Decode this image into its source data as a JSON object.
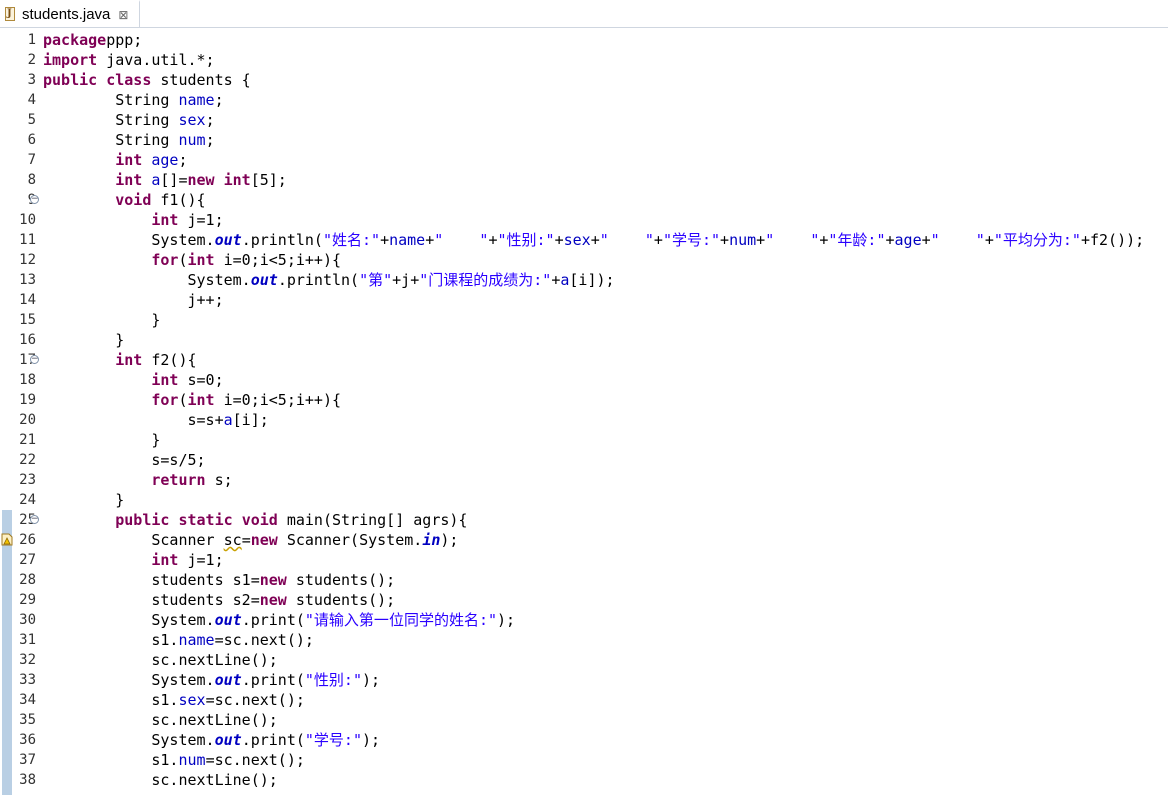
{
  "tab": {
    "title": "students.java",
    "close": "⊠",
    "icon": "java-file-icon"
  },
  "colors": {
    "keyword": "#7f0055",
    "field": "#0000c0",
    "string": "#2a00ff",
    "line_number": "#333333",
    "ruler_marker": "#b9cfe4"
  },
  "lines": [
    {
      "n": "1",
      "t": [
        [
          "kw",
          "package"
        ],
        [
          "",
          "ppp;"
        ]
      ]
    },
    {
      "n": "2",
      "t": [
        [
          "kw",
          "import"
        ],
        [
          "",
          " java.util.*;"
        ]
      ]
    },
    {
      "n": "3",
      "t": [
        [
          "kw",
          "public"
        ],
        [
          "",
          " "
        ],
        [
          "kw",
          "class"
        ],
        [
          "",
          " students {"
        ]
      ]
    },
    {
      "n": "4",
      "t": [
        [
          "",
          "        String "
        ],
        [
          "fld",
          "name"
        ],
        [
          "",
          ";"
        ]
      ]
    },
    {
      "n": "5",
      "t": [
        [
          "",
          "        String "
        ],
        [
          "fld",
          "sex"
        ],
        [
          "",
          ";"
        ]
      ]
    },
    {
      "n": "6",
      "t": [
        [
          "",
          "        String "
        ],
        [
          "fld",
          "num"
        ],
        [
          "",
          ";"
        ]
      ]
    },
    {
      "n": "7",
      "t": [
        [
          "",
          "        "
        ],
        [
          "kw",
          "int"
        ],
        [
          "",
          " "
        ],
        [
          "fld",
          "age"
        ],
        [
          "",
          ";"
        ]
      ]
    },
    {
      "n": "8",
      "t": [
        [
          "",
          "        "
        ],
        [
          "kw",
          "int"
        ],
        [
          "",
          " "
        ],
        [
          "fld",
          "a"
        ],
        [
          "",
          "[]="
        ],
        [
          "kw",
          "new"
        ],
        [
          "",
          " "
        ],
        [
          "kw",
          "int"
        ],
        [
          "",
          "[5];"
        ]
      ]
    },
    {
      "n": "9",
      "fold": true,
      "t": [
        [
          "",
          "        "
        ],
        [
          "kw",
          "void"
        ],
        [
          "",
          " f1(){"
        ]
      ]
    },
    {
      "n": "10",
      "t": [
        [
          "",
          "            "
        ],
        [
          "kw",
          "int"
        ],
        [
          "",
          " j=1;"
        ]
      ]
    },
    {
      "n": "11",
      "t": [
        [
          "",
          "            System."
        ],
        [
          "sfld",
          "out"
        ],
        [
          "",
          ".println("
        ],
        [
          "str",
          "\"姓名:\""
        ],
        [
          "",
          "+"
        ],
        [
          "fld",
          "name"
        ],
        [
          "",
          "+"
        ],
        [
          "str",
          "\"    \""
        ],
        [
          "",
          "+"
        ],
        [
          "str",
          "\"性别:\""
        ],
        [
          "",
          "+"
        ],
        [
          "fld",
          "sex"
        ],
        [
          "",
          "+"
        ],
        [
          "str",
          "\"    \""
        ],
        [
          "",
          "+"
        ],
        [
          "str",
          "\"学号:\""
        ],
        [
          "",
          "+"
        ],
        [
          "fld",
          "num"
        ],
        [
          "",
          "+"
        ],
        [
          "str",
          "\"    \""
        ],
        [
          "",
          "+"
        ],
        [
          "str",
          "\"年龄:\""
        ],
        [
          "",
          "+"
        ],
        [
          "fld",
          "age"
        ],
        [
          "",
          "+"
        ],
        [
          "str",
          "\"    \""
        ],
        [
          "",
          "+"
        ],
        [
          "str",
          "\"平均分为:\""
        ],
        [
          "",
          "+f2());"
        ]
      ]
    },
    {
      "n": "12",
      "t": [
        [
          "",
          "            "
        ],
        [
          "kw",
          "for"
        ],
        [
          "",
          "("
        ],
        [
          "kw",
          "int"
        ],
        [
          "",
          " i=0;i<5;i++){"
        ]
      ]
    },
    {
      "n": "13",
      "t": [
        [
          "",
          "                System."
        ],
        [
          "sfld",
          "out"
        ],
        [
          "",
          ".println("
        ],
        [
          "str",
          "\"第\""
        ],
        [
          "",
          "+j+"
        ],
        [
          "str",
          "\"门课程的成绩为:\""
        ],
        [
          "",
          "+"
        ],
        [
          "fld",
          "a"
        ],
        [
          "",
          "[i]);"
        ]
      ]
    },
    {
      "n": "14",
      "t": [
        [
          "",
          "                j++;"
        ]
      ]
    },
    {
      "n": "15",
      "t": [
        [
          "",
          "            }"
        ]
      ]
    },
    {
      "n": "16",
      "t": [
        [
          "",
          "        }"
        ]
      ]
    },
    {
      "n": "17",
      "fold": true,
      "t": [
        [
          "",
          "        "
        ],
        [
          "kw",
          "int"
        ],
        [
          "",
          " f2(){"
        ]
      ]
    },
    {
      "n": "18",
      "t": [
        [
          "",
          "            "
        ],
        [
          "kw",
          "int"
        ],
        [
          "",
          " s=0;"
        ]
      ]
    },
    {
      "n": "19",
      "t": [
        [
          "",
          "            "
        ],
        [
          "kw",
          "for"
        ],
        [
          "",
          "("
        ],
        [
          "kw",
          "int"
        ],
        [
          "",
          " i=0;i<5;i++){"
        ]
      ]
    },
    {
      "n": "20",
      "t": [
        [
          "",
          "                s=s+"
        ],
        [
          "fld",
          "a"
        ],
        [
          "",
          "[i];"
        ]
      ]
    },
    {
      "n": "21",
      "t": [
        [
          "",
          "            }"
        ]
      ]
    },
    {
      "n": "22",
      "t": [
        [
          "",
          "            s=s/5;"
        ]
      ]
    },
    {
      "n": "23",
      "t": [
        [
          "",
          "            "
        ],
        [
          "kw",
          "return"
        ],
        [
          "",
          " s;"
        ]
      ]
    },
    {
      "n": "24",
      "t": [
        [
          "",
          "        }"
        ]
      ]
    },
    {
      "n": "25",
      "fold": true,
      "t": [
        [
          "",
          "        "
        ],
        [
          "kw",
          "public"
        ],
        [
          "",
          " "
        ],
        [
          "kw",
          "static"
        ],
        [
          "",
          " "
        ],
        [
          "kw",
          "void"
        ],
        [
          "",
          " main(String[] agrs){"
        ]
      ]
    },
    {
      "n": "26",
      "warn": true,
      "t": [
        [
          "",
          "            Scanner "
        ],
        [
          "squig",
          "sc"
        ],
        [
          "",
          "="
        ],
        [
          "kw",
          "new"
        ],
        [
          "",
          " Scanner(System."
        ],
        [
          "sfld",
          "in"
        ],
        [
          "",
          ");"
        ]
      ]
    },
    {
      "n": "27",
      "t": [
        [
          "",
          "            "
        ],
        [
          "kw",
          "int"
        ],
        [
          "",
          " j=1;"
        ]
      ]
    },
    {
      "n": "28",
      "t": [
        [
          "",
          "            students s1="
        ],
        [
          "kw",
          "new"
        ],
        [
          "",
          " students();"
        ]
      ]
    },
    {
      "n": "29",
      "t": [
        [
          "",
          "            students s2="
        ],
        [
          "kw",
          "new"
        ],
        [
          "",
          " students();"
        ]
      ]
    },
    {
      "n": "30",
      "t": [
        [
          "",
          "            System."
        ],
        [
          "sfld",
          "out"
        ],
        [
          "",
          ".print("
        ],
        [
          "str",
          "\"请输入第一位同学的姓名:\""
        ],
        [
          "",
          ");"
        ]
      ]
    },
    {
      "n": "31",
      "t": [
        [
          "",
          "            s1."
        ],
        [
          "fld",
          "name"
        ],
        [
          "",
          "=sc.next();"
        ]
      ]
    },
    {
      "n": "32",
      "t": [
        [
          "",
          "            sc.nextLine();"
        ]
      ]
    },
    {
      "n": "33",
      "t": [
        [
          "",
          "            System."
        ],
        [
          "sfld",
          "out"
        ],
        [
          "",
          ".print("
        ],
        [
          "str",
          "\"性别:\""
        ],
        [
          "",
          ");"
        ]
      ]
    },
    {
      "n": "34",
      "t": [
        [
          "",
          "            s1."
        ],
        [
          "fld",
          "sex"
        ],
        [
          "",
          "=sc.next();"
        ]
      ]
    },
    {
      "n": "35",
      "t": [
        [
          "",
          "            sc.nextLine();"
        ]
      ]
    },
    {
      "n": "36",
      "t": [
        [
          "",
          "            System."
        ],
        [
          "sfld",
          "out"
        ],
        [
          "",
          ".print("
        ],
        [
          "str",
          "\"学号:\""
        ],
        [
          "",
          ");"
        ]
      ]
    },
    {
      "n": "37",
      "t": [
        [
          "",
          "            s1."
        ],
        [
          "fld",
          "num"
        ],
        [
          "",
          "=sc.next();"
        ]
      ]
    },
    {
      "n": "38",
      "t": [
        [
          "",
          "            sc.nextLine();"
        ]
      ]
    }
  ]
}
